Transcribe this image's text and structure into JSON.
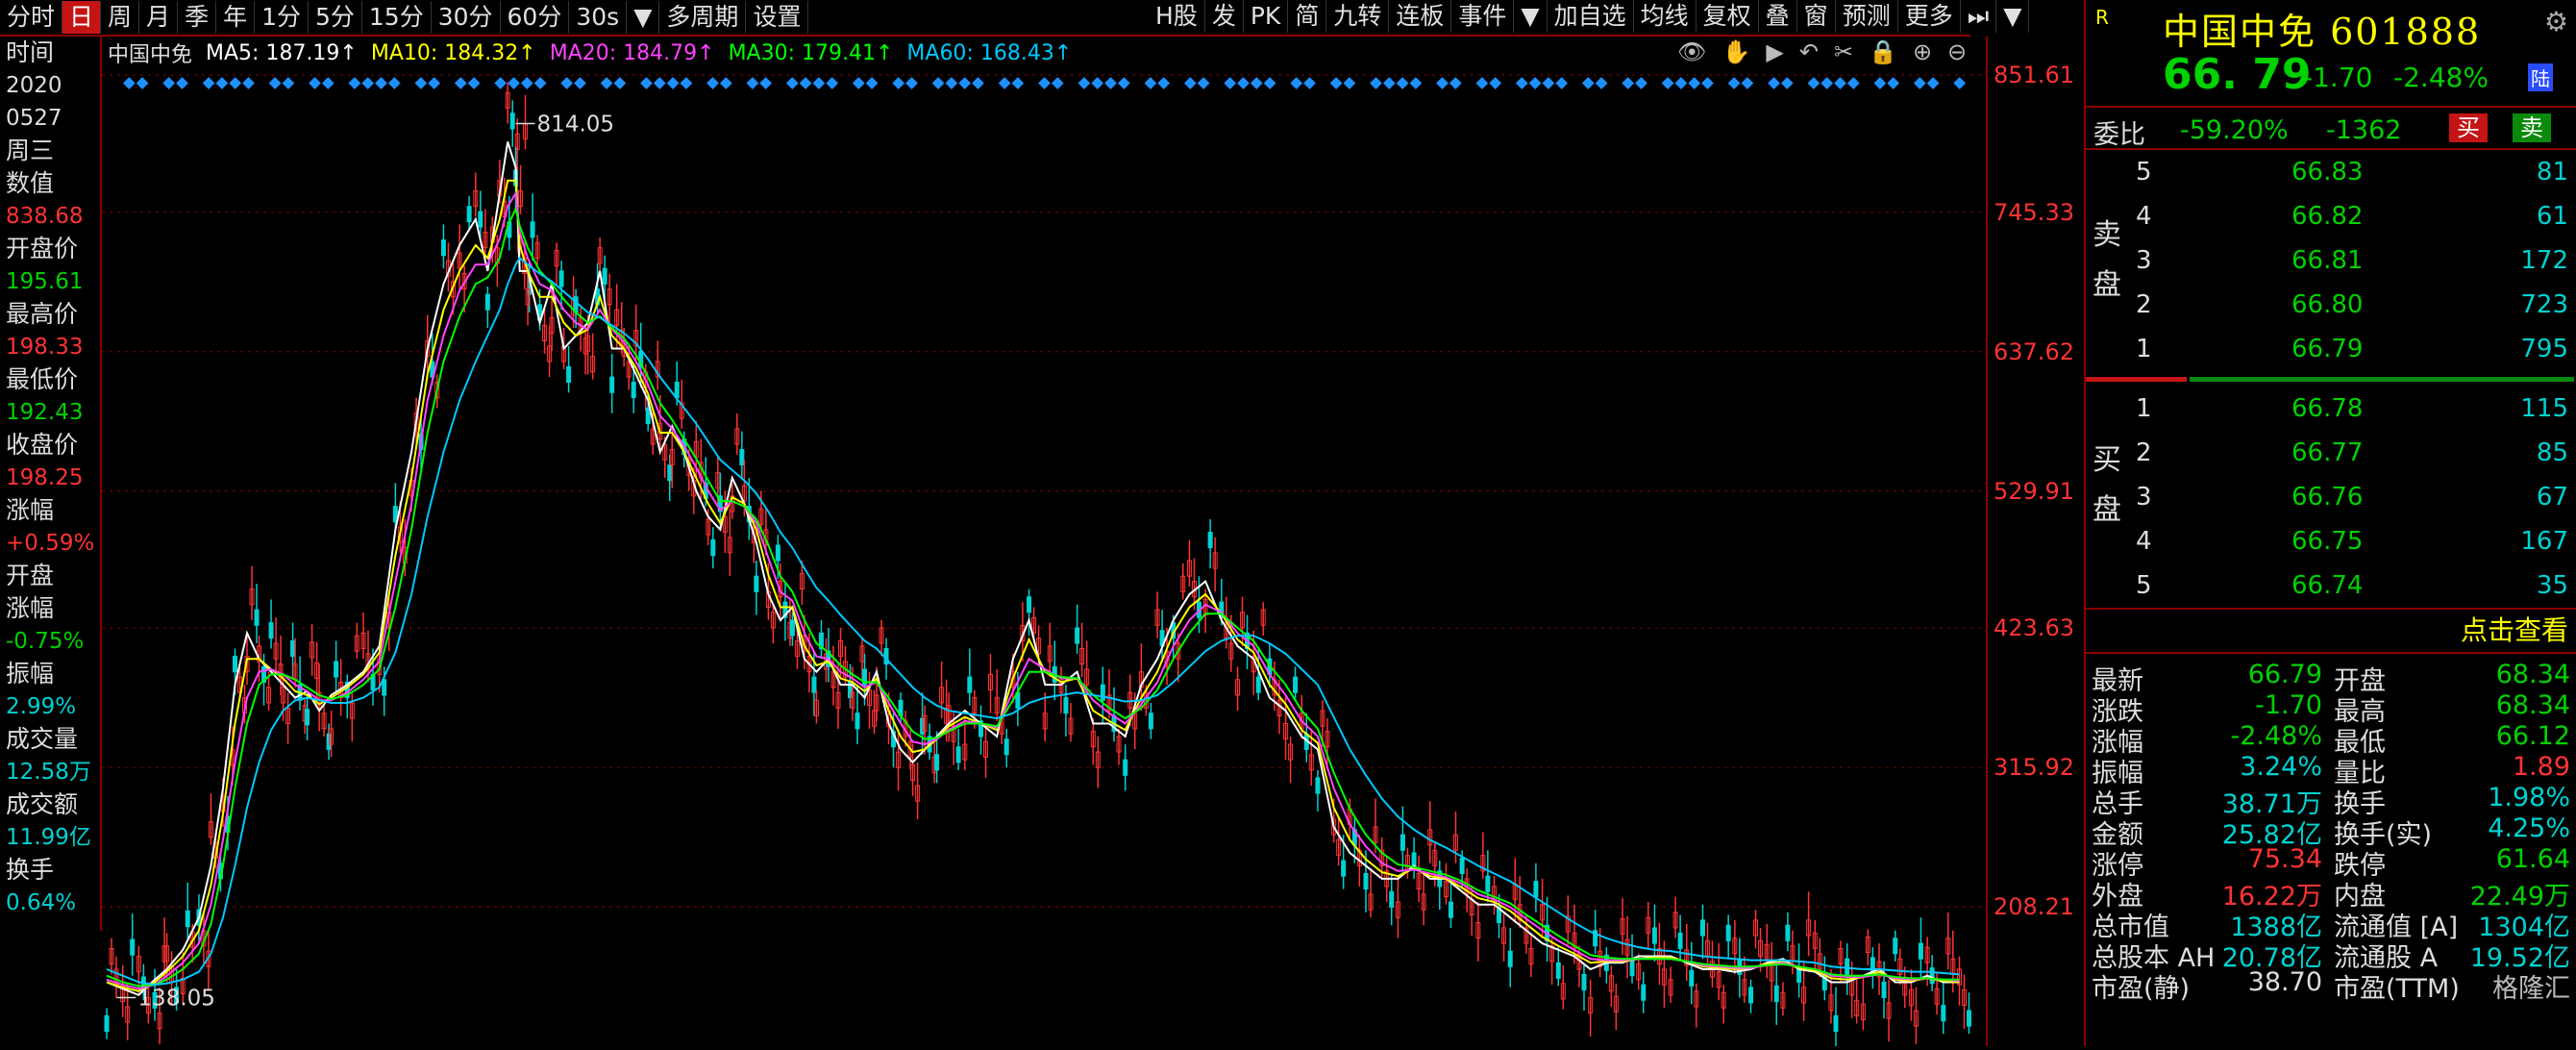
{
  "toolbar": {
    "left": [
      "分时",
      "日",
      "周",
      "月",
      "季",
      "年",
      "1分",
      "5分",
      "15分",
      "30分",
      "60分",
      "30s",
      "▼",
      "多周期",
      "设置"
    ],
    "active_index": 1,
    "right": [
      "H股",
      "发",
      "PK",
      "简",
      "九转",
      "连板",
      "事件",
      "▼",
      "加自选",
      "均线",
      "复权",
      "叠",
      "窗",
      "预测",
      "更多",
      "⏭",
      "▼"
    ]
  },
  "ma": {
    "name": "中国中免",
    "ma5": "MA5: 187.19↑",
    "ma10": "MA10: 184.32↑",
    "ma20": "MA20: 184.79↑",
    "ma30": "MA30: 179.41↑",
    "ma60": "MA60: 168.43↑",
    "colors": {
      "ma5": "#ffffff",
      "ma10": "#ffff00",
      "ma20": "#ff44ff",
      "ma30": "#00ff00",
      "ma60": "#00c8ff"
    }
  },
  "tools": [
    "👁",
    "✋",
    "▶",
    "↶",
    "✂",
    "🔒",
    "⊕",
    "⊖"
  ],
  "left_panel": [
    {
      "label": "时间",
      "value": "2020",
      "color": "#dddddd"
    },
    {
      "label": "",
      "value": "0527",
      "color": "#dddddd"
    },
    {
      "label": "周三",
      "value": "",
      "color": "#dddddd"
    },
    {
      "label": "数值",
      "value": "838.68",
      "color": "#ff3333"
    },
    {
      "label": "开盘价",
      "value": "195.61",
      "color": "#00d200"
    },
    {
      "label": "最高价",
      "value": "198.33",
      "color": "#ff3333"
    },
    {
      "label": "最低价",
      "value": "192.43",
      "color": "#00d200"
    },
    {
      "label": "收盘价",
      "value": "198.25",
      "color": "#ff3333"
    },
    {
      "label": "涨幅",
      "value": "+0.59%",
      "color": "#ff3333"
    },
    {
      "label": "开盘",
      "value": "",
      "color": "#dddddd"
    },
    {
      "label": "涨幅",
      "value": "-0.75%",
      "color": "#00d200"
    },
    {
      "label": "振幅",
      "value": "2.99%",
      "color": "#00d2d2"
    },
    {
      "label": "成交量",
      "value": "12.58万",
      "color": "#00d2d2"
    },
    {
      "label": "成交额",
      "value": "11.99亿",
      "color": "#00d2d2"
    },
    {
      "label": "换手",
      "value": "0.64%",
      "color": "#00d2d2"
    }
  ],
  "chart_data": {
    "type": "line",
    "y_ticks": [
      851.61,
      745.33,
      637.62,
      529.91,
      423.63,
      315.92,
      208.21
    ],
    "ylim": [
      100.5,
      851.61
    ],
    "annotations": [
      {
        "text": "814.05",
        "x": 204,
        "y": 814.05
      },
      {
        "text": "138.05",
        "x": 5,
        "y": 138.05
      }
    ],
    "x": [
      0,
      8,
      16,
      24,
      30,
      38,
      46,
      52,
      58,
      64,
      70,
      76,
      82,
      88,
      94,
      100,
      106,
      112,
      120,
      128,
      136,
      144,
      152,
      160,
      168,
      176,
      184,
      190,
      196,
      200,
      204,
      206,
      210,
      216,
      222,
      228,
      234,
      240,
      246,
      252,
      258,
      264,
      270,
      276,
      282,
      288,
      294,
      300,
      306,
      312,
      318,
      324,
      330,
      336,
      342,
      348,
      354,
      360,
      366,
      372,
      378,
      384,
      390,
      396,
      402,
      408,
      414,
      420,
      428,
      436,
      444,
      452,
      460,
      468,
      476,
      484,
      492,
      500,
      508,
      516,
      524,
      532,
      540,
      548,
      556,
      564,
      572,
      580,
      588,
      596,
      604,
      612,
      620,
      628,
      636,
      644,
      652,
      660,
      668,
      676,
      684,
      692,
      700,
      708,
      716,
      724,
      732,
      740,
      748,
      756,
      764,
      772,
      780,
      788,
      796,
      804,
      812,
      820,
      828,
      836,
      844,
      852,
      860,
      868,
      876,
      884,
      892,
      900,
      908,
      916,
      924,
      930
    ],
    "series": [
      {
        "name": "MA5",
        "color": "#ffffff",
        "values": [
          150,
          145,
          140,
          152,
          160,
          175,
          200,
          240,
          300,
          380,
          420,
          400,
          390,
          380,
          370,
          375,
          360,
          372,
          380,
          390,
          410,
          500,
          560,
          640,
          690,
          720,
          740,
          700,
          760,
          800,
          780,
          700,
          700,
          660,
          690,
          640,
          650,
          660,
          700,
          640,
          640,
          620,
          600,
          560,
          580,
          560,
          530,
          510,
          500,
          540,
          520,
          490,
          450,
          430,
          440,
          400,
          390,
          400,
          380,
          380,
          370,
          390,
          350,
          330,
          320,
          330,
          340,
          350,
          360,
          350,
          340,
          400,
          430,
          380,
          380,
          390,
          350,
          350,
          340,
          380,
          400,
          430,
          450,
          460,
          430,
          410,
          400,
          370,
          360,
          340,
          330,
          270,
          250,
          240,
          230,
          230,
          240,
          230,
          230,
          220,
          210,
          210,
          200,
          190,
          180,
          175,
          170,
          160,
          165,
          165,
          170,
          170,
          170,
          165,
          160,
          160,
          158,
          160,
          165,
          168,
          160,
          158,
          150,
          150,
          155,
          160,
          150,
          150,
          155,
          150,
          150
        ]
      },
      {
        "name": "MA10",
        "color": "#ffff00",
        "values": [
          150,
          146,
          143,
          150,
          158,
          170,
          190,
          225,
          280,
          350,
          400,
          400,
          392,
          385,
          375,
          372,
          365,
          370,
          378,
          388,
          405,
          480,
          540,
          620,
          670,
          700,
          720,
          710,
          740,
          770,
          770,
          720,
          700,
          680,
          680,
          660,
          650,
          655,
          680,
          650,
          640,
          625,
          605,
          575,
          575,
          560,
          540,
          520,
          505,
          525,
          520,
          500,
          465,
          440,
          440,
          410,
          395,
          398,
          385,
          382,
          375,
          385,
          360,
          340,
          328,
          330,
          338,
          348,
          355,
          350,
          345,
          385,
          415,
          390,
          382,
          385,
          360,
          352,
          345,
          370,
          390,
          420,
          440,
          450,
          435,
          415,
          405,
          380,
          365,
          345,
          335,
          285,
          260,
          245,
          235,
          232,
          238,
          232,
          230,
          223,
          215,
          212,
          205,
          195,
          185,
          178,
          172,
          165,
          166,
          166,
          168,
          169,
          169,
          166,
          162,
          161,
          160,
          161,
          164,
          166,
          161,
          159,
          153,
          152,
          154,
          158,
          152,
          151,
          153,
          151,
          150
        ]
      },
      {
        "name": "MA20",
        "color": "#ff44ff",
        "values": [
          152,
          148,
          145,
          148,
          155,
          165,
          180,
          210,
          260,
          320,
          370,
          390,
          392,
          388,
          380,
          375,
          368,
          368,
          374,
          384,
          398,
          460,
          520,
          600,
          650,
          685,
          705,
          705,
          725,
          750,
          760,
          730,
          710,
          690,
          685,
          670,
          660,
          655,
          670,
          655,
          645,
          630,
          612,
          588,
          578,
          565,
          548,
          530,
          515,
          522,
          518,
          505,
          478,
          452,
          445,
          420,
          402,
          400,
          390,
          385,
          378,
          382,
          366,
          350,
          336,
          334,
          338,
          345,
          352,
          350,
          347,
          375,
          400,
          392,
          385,
          385,
          368,
          358,
          350,
          365,
          382,
          410,
          430,
          442,
          436,
          420,
          410,
          388,
          372,
          352,
          340,
          300,
          272,
          255,
          242,
          236,
          237,
          234,
          231,
          226,
          218,
          214,
          208,
          199,
          190,
          182,
          175,
          168,
          167,
          167,
          168,
          168,
          168,
          166,
          163,
          162,
          161,
          161,
          163,
          165,
          162,
          160,
          155,
          154,
          154,
          156,
          153,
          152,
          153,
          152,
          151
        ]
      },
      {
        "name": "MA30",
        "color": "#00ff00",
        "values": [
          155,
          150,
          147,
          148,
          152,
          160,
          172,
          195,
          240,
          300,
          350,
          380,
          388,
          388,
          384,
          378,
          372,
          369,
          372,
          380,
          392,
          440,
          500,
          575,
          630,
          665,
          690,
          695,
          710,
          735,
          748,
          735,
          718,
          700,
          690,
          678,
          668,
          660,
          665,
          656,
          648,
          635,
          618,
          598,
          585,
          570,
          555,
          538,
          522,
          522,
          518,
          508,
          488,
          464,
          452,
          430,
          412,
          405,
          395,
          388,
          382,
          382,
          370,
          356,
          344,
          338,
          339,
          344,
          350,
          350,
          348,
          368,
          390,
          390,
          386,
          385,
          372,
          362,
          354,
          362,
          376,
          400,
          420,
          435,
          435,
          424,
          414,
          395,
          380,
          360,
          346,
          312,
          284,
          264,
          250,
          241,
          239,
          236,
          233,
          228,
          221,
          216,
          211,
          202,
          194,
          186,
          178,
          171,
          169,
          168,
          168,
          168,
          168,
          166,
          164,
          163,
          162,
          162,
          163,
          164,
          162,
          160,
          156,
          155,
          155,
          156,
          154,
          153,
          153,
          152,
          152
        ]
      },
      {
        "name": "MA60",
        "color": "#00c8ff",
        "values": [
          160,
          155,
          150,
          148,
          149,
          152,
          158,
          172,
          200,
          240,
          285,
          320,
          345,
          360,
          368,
          370,
          368,
          366,
          366,
          370,
          378,
          405,
          450,
          510,
          560,
          600,
          630,
          650,
          670,
          690,
          705,
          710,
          705,
          698,
          692,
          684,
          676,
          668,
          664,
          658,
          652,
          644,
          632,
          618,
          606,
          594,
          582,
          568,
          554,
          546,
          538,
          528,
          514,
          498,
          486,
          470,
          455,
          445,
          434,
          424,
          414,
          408,
          398,
          388,
          378,
          370,
          364,
          360,
          358,
          356,
          354,
          358,
          366,
          370,
          372,
          374,
          372,
          370,
          367,
          368,
          372,
          382,
          394,
          406,
          414,
          418,
          418,
          412,
          404,
          392,
          380,
          355,
          330,
          310,
          292,
          278,
          268,
          260,
          254,
          247,
          240,
          234,
          228,
          220,
          212,
          204,
          196,
          189,
          184,
          180,
          177,
          175,
          174,
          172,
          170,
          169,
          168,
          167,
          167,
          167,
          166,
          165,
          162,
          161,
          160,
          160,
          159,
          158,
          158,
          157,
          156
        ]
      }
    ]
  },
  "quote": {
    "r_badge": "R",
    "name_code": "中国中免 601888",
    "price": "66. 79",
    "change": "-1.70",
    "pct": "-2.48%",
    "lu_badge": "陆",
    "weibi_label": "委比",
    "weibi_pct": "-59.20%",
    "weibi_diff": "-1362",
    "buy_label": "买",
    "sell_label": "卖",
    "sell_side": [
      "卖",
      "盘"
    ],
    "buy_side": [
      "买",
      "盘"
    ],
    "asks": [
      {
        "n": "5",
        "p": "66.83",
        "q": "81"
      },
      {
        "n": "4",
        "p": "66.82",
        "q": "61"
      },
      {
        "n": "3",
        "p": "66.81",
        "q": "172"
      },
      {
        "n": "2",
        "p": "66.80",
        "q": "723"
      },
      {
        "n": "1",
        "p": "66.79",
        "q": "795"
      }
    ],
    "bids": [
      {
        "n": "1",
        "p": "66.78",
        "q": "115"
      },
      {
        "n": "2",
        "p": "66.77",
        "q": "85"
      },
      {
        "n": "3",
        "p": "66.76",
        "q": "67"
      },
      {
        "n": "4",
        "p": "66.75",
        "q": "167"
      },
      {
        "n": "5",
        "p": "66.74",
        "q": "35"
      }
    ],
    "click_more": "点击查看",
    "stats": [
      {
        "k": "最新",
        "v": "66.79",
        "c": "#00d200",
        "k2": "开盘",
        "v2": "68.34",
        "c2": "#00d200"
      },
      {
        "k": "涨跌",
        "v": "-1.70",
        "c": "#00d200",
        "k2": "最高",
        "v2": "68.34",
        "c2": "#00d200"
      },
      {
        "k": "涨幅",
        "v": "-2.48%",
        "c": "#00d200",
        "k2": "最低",
        "v2": "66.12",
        "c2": "#00d200"
      },
      {
        "k": "振幅",
        "v": "3.24%",
        "c": "#00d2d2",
        "k2": "量比",
        "v2": "1.89",
        "c2": "#ff3333"
      },
      {
        "k": "总手",
        "v": "38.71万",
        "c": "#00d2d2",
        "k2": "换手",
        "v2": "1.98%",
        "c2": "#00d2d2"
      },
      {
        "k": "金额",
        "v": "25.82亿",
        "c": "#00d2d2",
        "k2": "换手(实)",
        "v2": "4.25%",
        "c2": "#00d2d2"
      },
      {
        "k": "涨停",
        "v": "75.34",
        "c": "#ff3333",
        "k2": "跌停",
        "v2": "61.64",
        "c2": "#00d200"
      },
      {
        "k": "外盘",
        "v": "16.22万",
        "c": "#ff3333",
        "k2": "内盘",
        "v2": "22.49万",
        "c2": "#00d200"
      },
      {
        "k": "总市值",
        "v": "1388亿",
        "c": "#00d2d2",
        "k2": "流通值 [A]",
        "v2": "1304亿",
        "c2": "#00d2d2"
      },
      {
        "k": "总股本 AH",
        "v": "20.78亿",
        "c": "#00d2d2",
        "k2": "流通股 A",
        "v2": "19.52亿",
        "c2": "#00d2d2"
      },
      {
        "k": "市盈(静)",
        "v": "38.70",
        "c": "#dddddd",
        "k2": "市盈(TTM)",
        "v2": "格隆汇",
        "c2": "#bbbbbb"
      }
    ]
  }
}
